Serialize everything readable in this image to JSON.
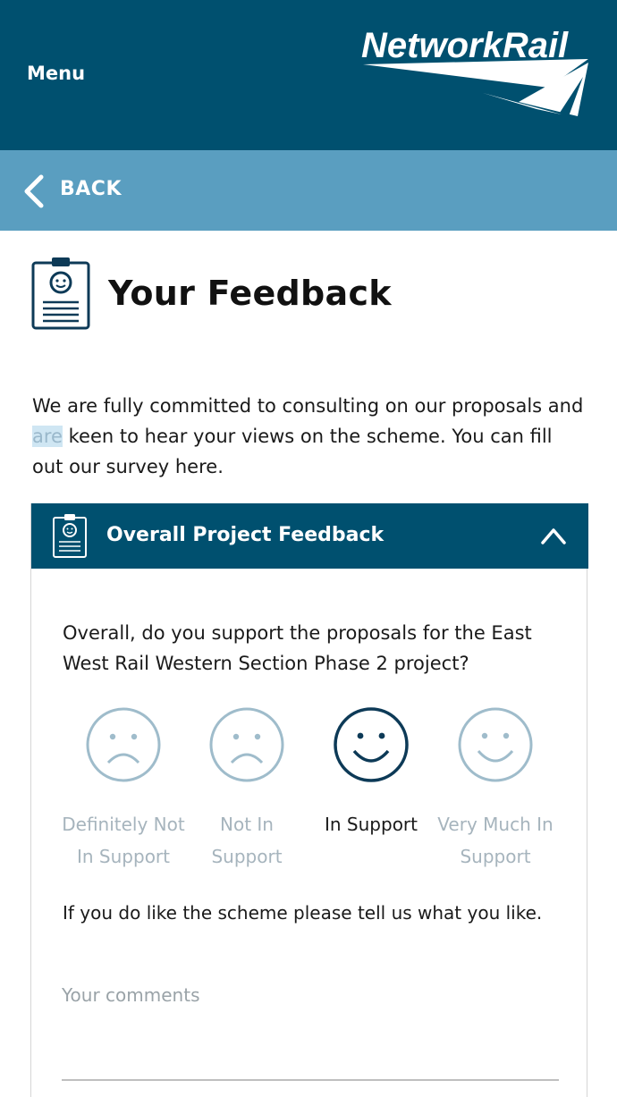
{
  "header": {
    "menu_label": "Menu",
    "logo_text": "NetworkRail"
  },
  "nav": {
    "back_label": "BACK"
  },
  "page": {
    "title": "Your Feedback",
    "intro_part1": "We are fully committed to consulting on our proposals and ",
    "intro_highlight": "are",
    "intro_part2": " keen to hear your views on the scheme. You can fill out our survey here."
  },
  "panel": {
    "title": "Overall Project Feedback",
    "question": "Overall, do you support the proposals for the East West Rail Western Section Phase 2 project?",
    "options": [
      {
        "label": "Definitely Not In Support",
        "icon": "sad-face-icon",
        "selected": false
      },
      {
        "label": "Not In Support",
        "icon": "sad-face-icon",
        "selected": false
      },
      {
        "label": "In Support",
        "icon": "happy-face-icon",
        "selected": true
      },
      {
        "label": "Very Much In Support",
        "icon": "happy-face-icon",
        "selected": false
      }
    ],
    "prompt": "If you do like the scheme please tell us what you like.",
    "comments_placeholder": "Your comments"
  },
  "colors": {
    "brand_dark": "#00506f",
    "back_bar": "#5a9ec0",
    "face_muted": "#9fbccb",
    "face_selected": "#0d3a57"
  }
}
